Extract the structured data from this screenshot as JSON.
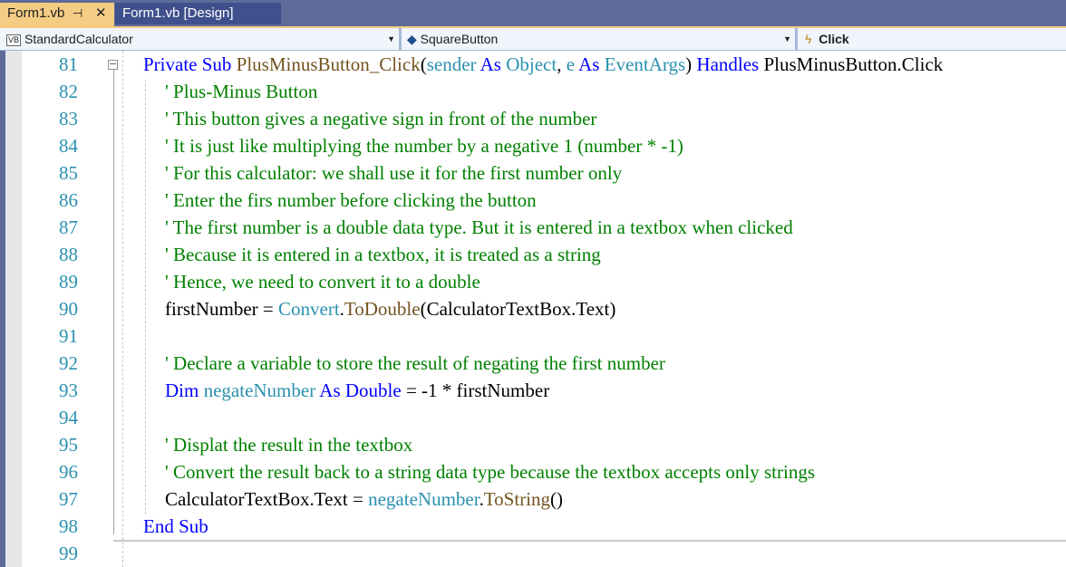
{
  "tabs": [
    {
      "label": "Form1.vb",
      "active": true,
      "pin_icon": "pin-icon",
      "close_icon": "close-icon"
    },
    {
      "label": "Form1.vb [Design]",
      "active": false
    }
  ],
  "navbar": {
    "project": {
      "badge": "VB",
      "label": "StandardCalculator"
    },
    "object": {
      "label": "SquareButton",
      "icon": "class-icon"
    },
    "event": {
      "label": "Click",
      "icon": "lightning-icon"
    }
  },
  "colors": {
    "keyword": "#0000ff",
    "method": "#74531f",
    "type": "#2b91af",
    "comment": "#008000",
    "line_number": "#2b91af",
    "tab_active": "#f5cc84",
    "tabbar": "#5d6b99"
  },
  "lines": [
    {
      "n": "81",
      "indent": 0,
      "tokens": [
        [
          "kw",
          "Private Sub "
        ],
        [
          "fn",
          "PlusMinusButton_Click"
        ],
        [
          "tx",
          "("
        ],
        [
          "ty",
          "sender "
        ],
        [
          "kw",
          "As "
        ],
        [
          "ty",
          "Object"
        ],
        [
          "tx",
          ", "
        ],
        [
          "ty",
          "e "
        ],
        [
          "kw",
          "As "
        ],
        [
          "ty",
          "EventArgs"
        ],
        [
          "tx",
          ") "
        ],
        [
          "kw",
          "Handles "
        ],
        [
          "tx",
          "PlusMinusButton.Click"
        ]
      ]
    },
    {
      "n": "82",
      "indent": 1,
      "tokens": [
        [
          "cm",
          "' Plus-Minus Button"
        ]
      ]
    },
    {
      "n": "83",
      "indent": 1,
      "tokens": [
        [
          "cm",
          "' This button gives a negative sign in front of the number"
        ]
      ]
    },
    {
      "n": "84",
      "indent": 1,
      "tokens": [
        [
          "cm",
          "' It is just like multiplying the number by a negative 1 (number * -1)"
        ]
      ]
    },
    {
      "n": "85",
      "indent": 1,
      "tokens": [
        [
          "cm",
          "' For this calculator: we shall use it for the first number only"
        ]
      ]
    },
    {
      "n": "86",
      "indent": 1,
      "tokens": [
        [
          "cm",
          "' Enter the firs number before clicking the button"
        ]
      ]
    },
    {
      "n": "87",
      "indent": 1,
      "tokens": [
        [
          "cm",
          "' The first number is a double data type. But it is entered in a textbox when clicked"
        ]
      ]
    },
    {
      "n": "88",
      "indent": 1,
      "tokens": [
        [
          "cm",
          "' Because it is entered in a textbox, it is treated as a string"
        ]
      ]
    },
    {
      "n": "89",
      "indent": 1,
      "tokens": [
        [
          "cm",
          "' Hence, we need to convert it to a double"
        ]
      ]
    },
    {
      "n": "90",
      "indent": 1,
      "tokens": [
        [
          "tx",
          "firstNumber = "
        ],
        [
          "ty",
          "Convert"
        ],
        [
          "tx",
          "."
        ],
        [
          "fn",
          "ToDouble"
        ],
        [
          "tx",
          "(CalculatorTextBox.Text)"
        ]
      ]
    },
    {
      "n": "91",
      "indent": 1,
      "tokens": []
    },
    {
      "n": "92",
      "indent": 1,
      "tokens": [
        [
          "cm",
          "' Declare a variable to store the result of negating the first number"
        ]
      ]
    },
    {
      "n": "93",
      "indent": 1,
      "tokens": [
        [
          "kw",
          "Dim "
        ],
        [
          "ty",
          "negateNumber "
        ],
        [
          "kw",
          "As Double "
        ],
        [
          "tx",
          "= -1 * firstNumber"
        ]
      ]
    },
    {
      "n": "94",
      "indent": 1,
      "tokens": []
    },
    {
      "n": "95",
      "indent": 1,
      "tokens": [
        [
          "cm",
          "' Displat the result in the textbox"
        ]
      ]
    },
    {
      "n": "96",
      "indent": 1,
      "tokens": [
        [
          "cm",
          "' Convert the result back to a string data type because the textbox accepts only strings"
        ]
      ]
    },
    {
      "n": "97",
      "indent": 1,
      "tokens": [
        [
          "tx",
          "CalculatorTextBox.Text = "
        ],
        [
          "ty",
          "negateNumber"
        ],
        [
          "tx",
          "."
        ],
        [
          "fn",
          "ToString"
        ],
        [
          "tx",
          "()"
        ]
      ]
    },
    {
      "n": "98",
      "indent": 0,
      "tokens": [
        [
          "kw",
          "End Sub"
        ]
      ]
    },
    {
      "n": "99",
      "indent": 0,
      "tokens": []
    }
  ]
}
